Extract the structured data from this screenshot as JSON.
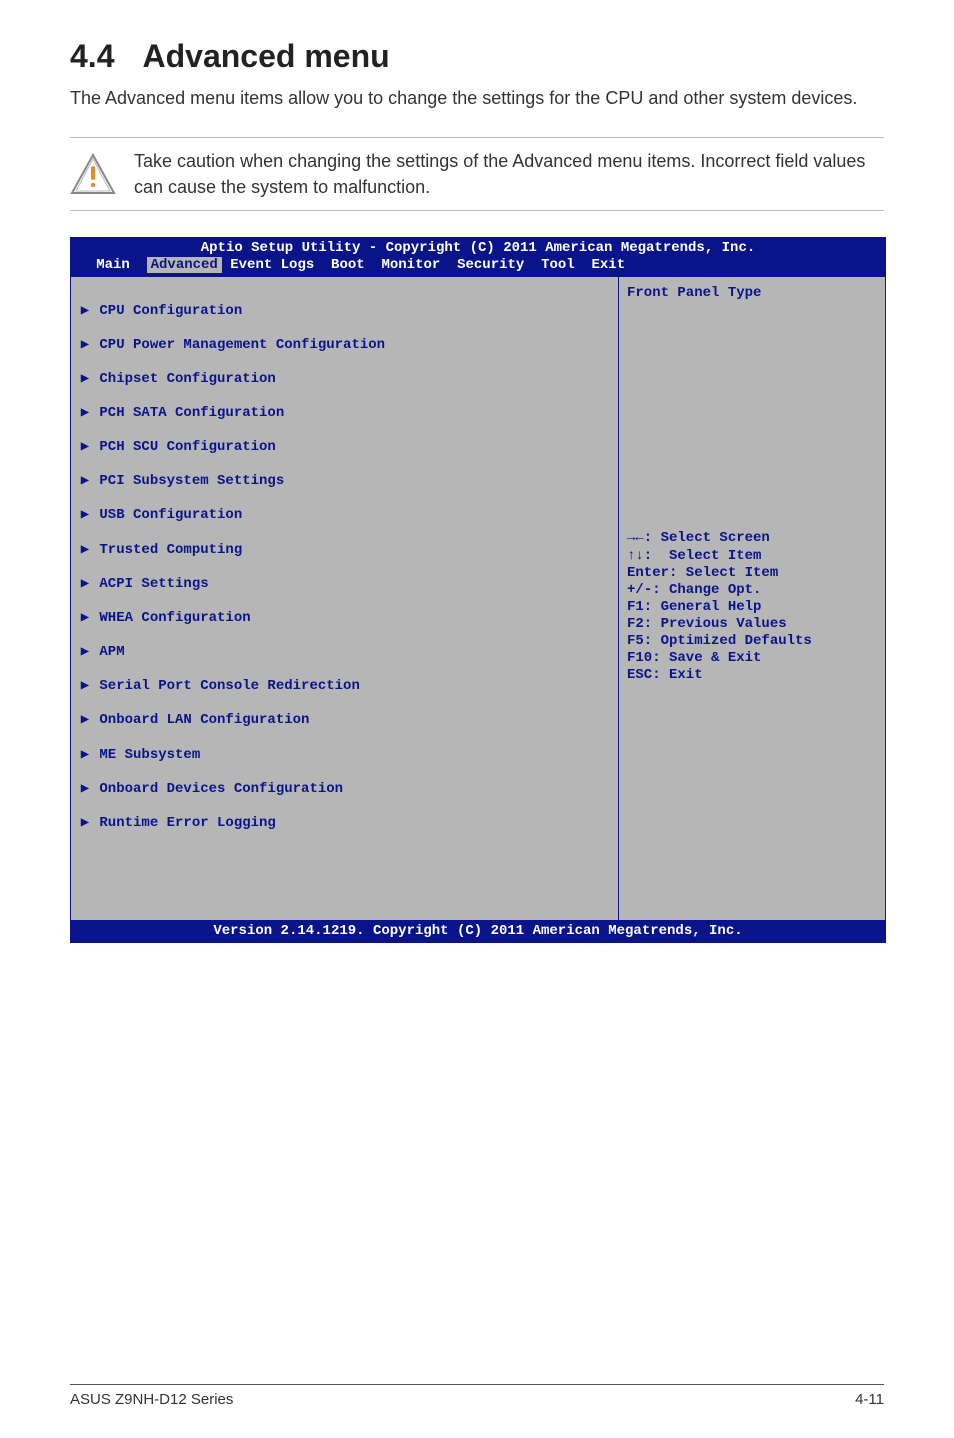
{
  "heading": {
    "number": "4.4",
    "title": "Advanced menu"
  },
  "intro": "The Advanced menu items allow you to change the settings for the CPU and other system devices.",
  "caution": "Take caution when changing the settings of the Advanced menu items. Incorrect field values can cause the system to malfunction.",
  "bios": {
    "header_line": "Aptio Setup Utility - Copyright (C) 2011 American Megatrends, Inc.",
    "tabs": {
      "prefix": "   Main  ",
      "active": "Advanced",
      "suffix": " Event Logs  Boot  Monitor  Security  Tool  Exit"
    },
    "side_help_title": "Front Panel Type",
    "menu_items": [
      "CPU Configuration",
      "CPU Power Management Configuration",
      "Chipset Configuration",
      "PCH SATA Configuration",
      "PCH SCU Configuration",
      "PCI Subsystem Settings",
      "USB Configuration",
      "Trusted Computing",
      "ACPI Settings",
      "WHEA Configuration",
      "APM",
      "Serial Port Console Redirection",
      "Onboard LAN Configuration",
      "ME Subsystem",
      "Onboard Devices Configuration",
      "Runtime Error Logging"
    ],
    "hints": [
      "→←: Select Screen",
      "↑↓:  Select Item",
      "Enter: Select Item",
      "+/-: Change Opt.",
      "F1: General Help",
      "F2: Previous Values",
      "F5: Optimized Defaults",
      "F10: Save & Exit",
      "ESC: Exit"
    ],
    "footer_line": "Version 2.14.1219. Copyright (C) 2011 American Megatrends, Inc."
  },
  "footer": {
    "left": "ASUS Z9NH-D12 Series",
    "right": "4-11"
  }
}
